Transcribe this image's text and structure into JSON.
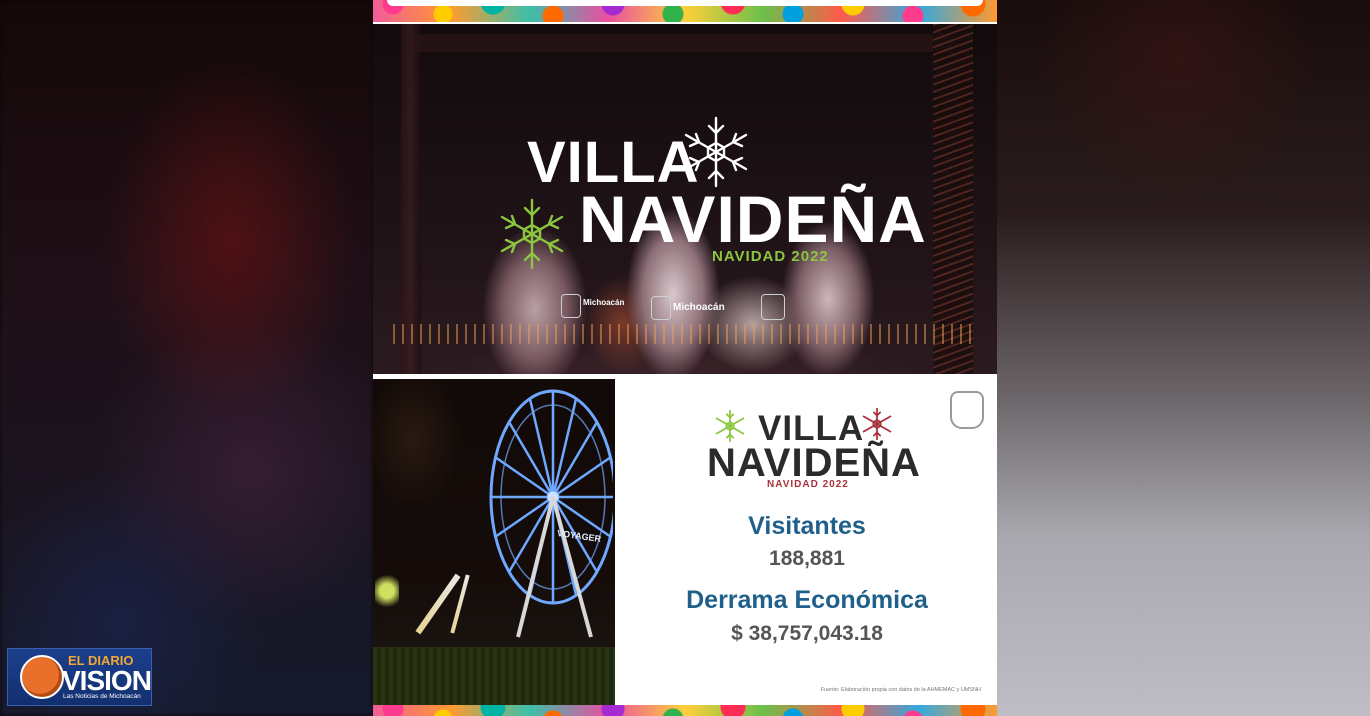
{
  "hero": {
    "title_line1": "VILLA",
    "title_line2": "NAVIDEÑA",
    "subtitle": "NAVIDAD 2022",
    "logo_text_1": "Michoacán",
    "logo_text_2": "Michoacán"
  },
  "stats_panel": {
    "title_line1": "VILLA",
    "title_line2": "NAVIDEÑA",
    "subtitle": "NAVIDAD 2022",
    "visitors_label": "Visitantes",
    "visitors_value": "188,881",
    "economic_label": "Derrama Económica",
    "economic_value": "$ 38,757,043.18",
    "source": "Fuente: Elaboración propia con datos de la AHMEMAC y UMSNH"
  },
  "wheel_sign": "VOYAGER",
  "watermark": {
    "top": "EL DIARIO",
    "main": "VISION",
    "tagline": "Las Noticias de Michoacán"
  },
  "colors": {
    "accent_green": "#8cc63f",
    "accent_red": "#a8323c",
    "stats_blue": "#1f5f8b",
    "watermark_blue": "#1c3f8c",
    "watermark_orange": "#e8702a"
  },
  "icons": [
    "snowflake-icon",
    "michoacan-seal-icon"
  ]
}
